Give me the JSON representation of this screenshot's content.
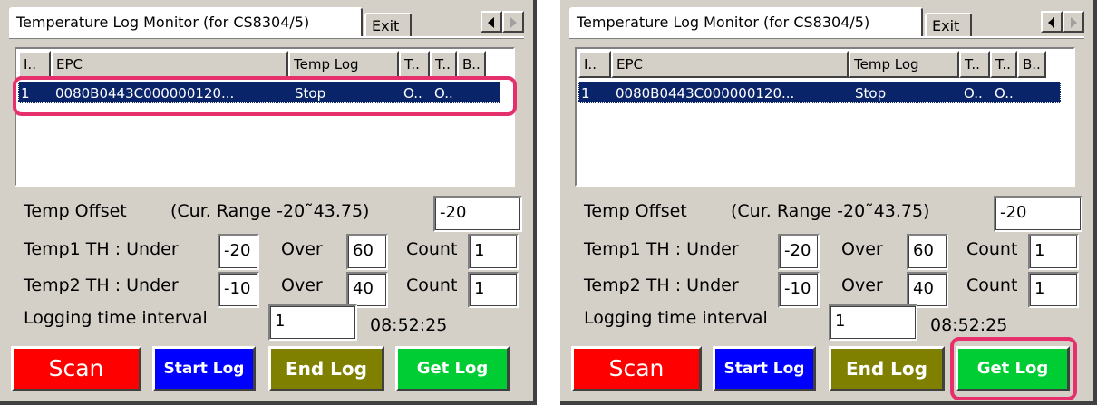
{
  "panels": [
    {
      "tabs": {
        "active_label": "Temperature Log Monitor (for CS8304/5)",
        "exit_label": "Exit"
      },
      "list": {
        "columns": [
          "I..",
          "EPC",
          "Temp Log",
          "T..",
          "T..",
          "B.."
        ],
        "rows": [
          {
            "index": "1",
            "epc": "0080B0443C000000120...",
            "temp_log": "Stop",
            "t1": "O..",
            "t2": "O..",
            "b": ""
          }
        ]
      },
      "form": {
        "temp_offset_label": "Temp Offset",
        "range_label": "(Cur. Range -20˜43.75)",
        "temp_offset_value": "-20",
        "temp1_label": "Temp1 TH : Under",
        "temp1_under": "-20",
        "temp1_over_label": "Over",
        "temp1_over": "60",
        "temp1_count_label": "Count",
        "temp1_count": "1",
        "temp2_label": "Temp2 TH : Under",
        "temp2_under": "-10",
        "temp2_over_label": "Over",
        "temp2_over": "40",
        "temp2_count_label": "Count",
        "temp2_count": "1",
        "interval_label": "Logging time interval",
        "interval_value": "1",
        "clock": "08:52:25"
      },
      "buttons": {
        "scan": "Scan",
        "start_log": "Start Log",
        "end_log": "End Log",
        "get_log": "Get Log"
      },
      "highlight": "list-row"
    },
    {
      "tabs": {
        "active_label": "Temperature Log Monitor (for CS8304/5)",
        "exit_label": "Exit"
      },
      "list": {
        "columns": [
          "I..",
          "EPC",
          "Temp Log",
          "T..",
          "T..",
          "B.."
        ],
        "rows": [
          {
            "index": "1",
            "epc": "0080B0443C000000120...",
            "temp_log": "Stop",
            "t1": "O..",
            "t2": "O..",
            "b": ""
          }
        ]
      },
      "form": {
        "temp_offset_label": "Temp Offset",
        "range_label": "(Cur. Range -20˜43.75)",
        "temp_offset_value": "-20",
        "temp1_label": "Temp1 TH : Under",
        "temp1_under": "-20",
        "temp1_over_label": "Over",
        "temp1_over": "60",
        "temp1_count_label": "Count",
        "temp1_count": "1",
        "temp2_label": "Temp2 TH : Under",
        "temp2_under": "-10",
        "temp2_over_label": "Over",
        "temp2_over": "40",
        "temp2_count_label": "Count",
        "temp2_count": "1",
        "interval_label": "Logging time interval",
        "interval_value": "1",
        "clock": "08:52:25"
      },
      "buttons": {
        "scan": "Scan",
        "start_log": "Start Log",
        "end_log": "End Log",
        "get_log": "Get Log"
      },
      "highlight": "get-log-button"
    }
  ],
  "colors": {
    "highlight": "#e5306c",
    "selection": "#0a246a",
    "scan": "#ff0000",
    "start_log": "#0000ff",
    "end_log": "#808000",
    "get_log": "#00cc33"
  }
}
